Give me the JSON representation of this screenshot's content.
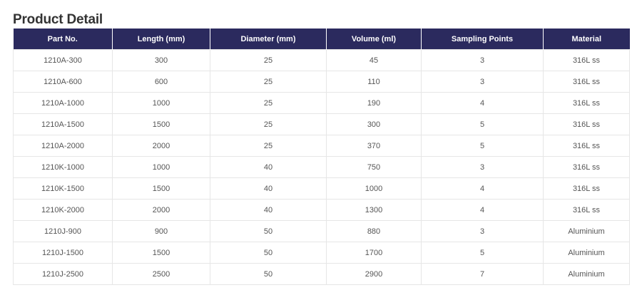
{
  "page": {
    "title": "Product Detail"
  },
  "table": {
    "headers": [
      "Part No.",
      "Length (mm)",
      "Diameter (mm)",
      "Volume (ml)",
      "Sampling Points",
      "Material"
    ],
    "rows": [
      [
        "1210A-300",
        "300",
        "25",
        "45",
        "3",
        "316L ss"
      ],
      [
        "1210A-600",
        "600",
        "25",
        "110",
        "3",
        "316L ss"
      ],
      [
        "1210A-1000",
        "1000",
        "25",
        "190",
        "4",
        "316L ss"
      ],
      [
        "1210A-1500",
        "1500",
        "25",
        "300",
        "5",
        "316L ss"
      ],
      [
        "1210A-2000",
        "2000",
        "25",
        "370",
        "5",
        "316L ss"
      ],
      [
        "1210K-1000",
        "1000",
        "40",
        "750",
        "3",
        "316L ss"
      ],
      [
        "1210K-1500",
        "1500",
        "40",
        "1000",
        "4",
        "316L ss"
      ],
      [
        "1210K-2000",
        "2000",
        "40",
        "1300",
        "4",
        "316L ss"
      ],
      [
        "1210J-900",
        "900",
        "50",
        "880",
        "3",
        "Aluminium"
      ],
      [
        "1210J-1500",
        "1500",
        "50",
        "1700",
        "5",
        "Aluminium"
      ],
      [
        "1210J-2500",
        "2500",
        "50",
        "2900",
        "7",
        "Aluminium"
      ]
    ]
  },
  "colors": {
    "header_bg": "#2b2a5e",
    "header_text": "#ffffff",
    "cell_text": "#555555",
    "border": "#e6e6e6"
  }
}
